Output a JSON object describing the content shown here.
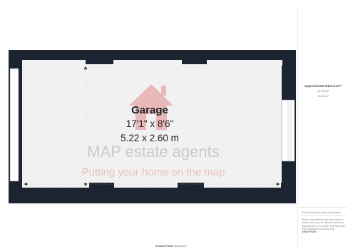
{
  "room": {
    "name": "Garage",
    "dims_imperial": "17'1\" x 8'6\"",
    "dims_metric": "5.22 x 2.60 m"
  },
  "watermark": {
    "name": "MAP estate agents",
    "tagline": "Putting your home on the map"
  },
  "area": {
    "title": "Approximate total area⁽¹⁾",
    "sq_ft": "147.98 ft²",
    "sq_m": "13.68 m²"
  },
  "notes": {
    "excluded": "(1) Excluding balconies and terraces",
    "disclaimer": "Whilst every attempt has been made to ensure accuracy, all measurements are approximate, not to scale. This floor plan is for illustrative purposes only."
  },
  "credit": "GIRAFFE360",
  "floor": {
    "name": "Ground Floor",
    "building": "Building 2"
  },
  "colors": {
    "wall": "#1c2431",
    "floor": "#f1f1f1",
    "watermark_gray": "#c4c4c4",
    "watermark_red": "#d9534f"
  }
}
